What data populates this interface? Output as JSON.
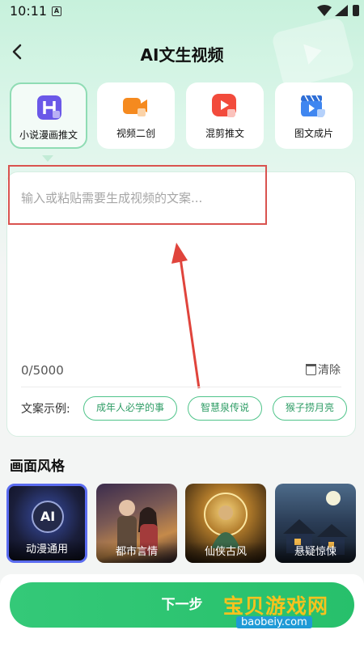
{
  "status_bar": {
    "time": "10:11",
    "notif_icon": "A"
  },
  "header": {
    "title": "AI文生视频",
    "back_icon": "chevron-left-icon"
  },
  "mode_tabs": [
    {
      "label": "小说漫画推文",
      "icon": "h-badge-icon",
      "color": "#6a58e8",
      "active": true
    },
    {
      "label": "视频二创",
      "icon": "video-camera-icon",
      "color": "#f58a1f",
      "active": false
    },
    {
      "label": "混剪推文",
      "icon": "play-icon",
      "color": "#f24b3c",
      "active": false
    },
    {
      "label": "图文成片",
      "icon": "clapperboard-icon",
      "color": "#3f86f0",
      "active": false
    }
  ],
  "editor": {
    "placeholder": "输入或粘贴需要生成视频的文案...",
    "counter": "0/5000",
    "clear_label": "清除",
    "examples_label": "文案示例:",
    "examples": [
      "成年人必学的事",
      "智慧泉传说",
      "猴子捞月亮"
    ]
  },
  "style_section": {
    "title": "画面风格",
    "styles": [
      {
        "label": "动漫通用",
        "badge": "AI",
        "selected": true
      },
      {
        "label": "都市言情",
        "selected": false
      },
      {
        "label": "仙侠古风",
        "selected": false
      },
      {
        "label": "悬疑惊悚",
        "selected": false
      }
    ]
  },
  "footer": {
    "next_label": "下一步"
  },
  "watermark": {
    "text": "宝贝游戏网",
    "url": "baobeiy.com"
  },
  "colors": {
    "accent": "#34c978",
    "highlight_red": "#d9534f",
    "selected_border": "#5b6cf0"
  }
}
